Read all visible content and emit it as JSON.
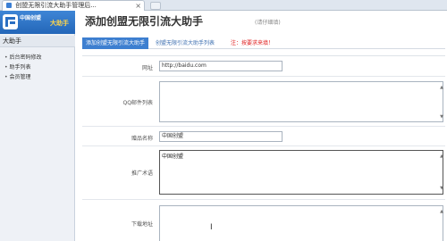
{
  "browser": {
    "tab_title": "创盟无限引流大助手管理后...",
    "close_glyph": "×"
  },
  "sidebar": {
    "logo_text_1": "中国创盟",
    "logo_text_2": "大助手",
    "section_title": "大助手",
    "items": [
      {
        "label": "后台密码修改"
      },
      {
        "label": "助手列表"
      },
      {
        "label": "会员管理"
      }
    ]
  },
  "main": {
    "title": "添加创盟无限引流大助手",
    "subtitle": "(请仔细填)",
    "tabs": [
      {
        "label": "添加创盟无限引流大助手"
      },
      {
        "label": "创盟无限引流大助手列表"
      }
    ],
    "note": "注：按要求来填！"
  },
  "form": {
    "url_label": "网址",
    "url_value": "http://baidu.com",
    "qq_label": "QQ邮件列表",
    "qq_value": "",
    "name_label": "赠品名称",
    "name_value": "中国创盟",
    "promo_label": "推广术语",
    "promo_value": "中国创盟",
    "download_label": "下载地址",
    "download_value": ""
  },
  "colors": {
    "accent": "#3d7fd0",
    "note_red": "#e02020",
    "logo_yellow": "#ffd54a"
  }
}
